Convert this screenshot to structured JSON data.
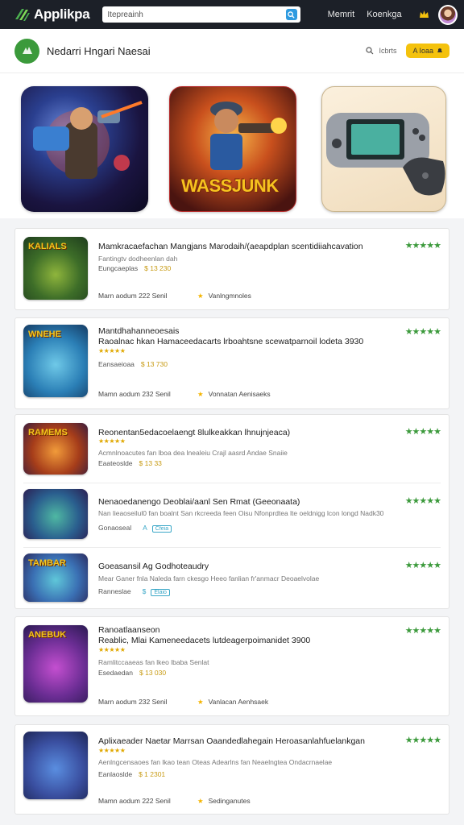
{
  "topbar": {
    "logo": "Applikpa",
    "search_value": "Itepreainh",
    "nav": [
      "Memrit",
      "Koenkga"
    ]
  },
  "header": {
    "title": "Nedarri Hngari Naesai",
    "search_label": "Icbrts",
    "cta_label": "A Ioaa"
  },
  "featured": {
    "tile2_word": "WASSJUNK"
  },
  "colors": {
    "topbar": "#1c2028",
    "brand_green": "#3b9a3b",
    "star_green": "#3c9a3c",
    "cta_yellow": "#f4c20d"
  },
  "cards": [
    {
      "title": "Mamkracaefachan Mangjans Marodaih/(aeapdplan scentidiiahcavation",
      "title2": "",
      "sub1": "Fantingtv dodheenlan dah",
      "meta_label": "Eungcaeplas",
      "meta_value": "$ 13 230",
      "footer_left": "Marn aodum  222 Senil",
      "footer_right": "Vanlngmnoles",
      "rating": "★★★★★",
      "thumb_label": "KALIALS"
    },
    {
      "title": "Mantdhahanneoesais",
      "title2": "Raoalnac hkan Hamaceedacarts lrboahtsne scewatparnoil lodeta 3930",
      "stars": "★★★★★",
      "meta_label": "Eansaeioaa",
      "meta_value": "$ 13 730",
      "footer_left": "Mamn aodum  232 Senil",
      "footer_right": "Vonnatan Aenisaeks",
      "rating": "★★★★★",
      "thumb_label": "WNEHE"
    }
  ],
  "group": [
    {
      "title": "Reonentan5edacoelaengt 8lulkeakkan lhnujnjeaca)",
      "stars": "★★★★★",
      "sub1": "Acmnlnoacutes fan lboa dea lnealeiu Crajl aasrd Andae Snaiie",
      "meta_label": "Eaateoslde",
      "meta_value": "$ 13 33",
      "rating": "★★★★★",
      "thumb_label": "RAMEMS"
    },
    {
      "title": "Nenaoedanengo Deoblai/aanl Sen Rmat (Geeonaata)",
      "sub1": "Nan lieaoseilul0 fan boalnt San rkcreeda feen Oisu Nfonprdtea lte oeldnigg lcon longd Nadk30",
      "meta_label": "Gonaoseal",
      "meta_value": "A",
      "badge": "Cfeia",
      "rating": "★★★★★",
      "thumb_label": ""
    },
    {
      "title": "Goeasansil Ag Godhoteaudry",
      "sub1": "Mear Ganer fnla Naleda farn ckesgo Heeo fanlian fr'anmacr Deoaelvolae",
      "meta_label": "Ranneslae",
      "meta_value": "$",
      "badge": "Elaio",
      "rating": "★★★★★",
      "thumb_label": "TAMBAR"
    }
  ],
  "cards2": [
    {
      "title": "Ranoatlaanseon",
      "title2": "Reablic, Mlai Kameneedacets lutdeagerpoimanidet 3900",
      "stars": "★★★★★",
      "sub1": "Ramlitccaaeas fan lkeo lbaba Senlat",
      "meta_label": "Esedaedan",
      "meta_value": "$ 13 030",
      "footer_left": "Marn aodum  232 Senil",
      "footer_right": "Vanlacan Aenhsaek",
      "rating": "★★★★★",
      "thumb_label": "ANEBUK"
    },
    {
      "title": "Aplixaeader Naetar Marrsan Oaandedlahegain Heroasanlahfuelankgan",
      "title2": "",
      "stars": "★★★★★",
      "sub1": "Aenlngcensaoes fan lkao tean Oteas Adearlns fan Neaelngtea Ondacrnaelae",
      "meta_label": "Eanlaoslde",
      "meta_value": "$ 1 2301",
      "footer_left": "Mamn aodum  222 Senil",
      "footer_right": "Sedinganutes",
      "rating": "★★★★★",
      "thumb_label": ""
    }
  ]
}
